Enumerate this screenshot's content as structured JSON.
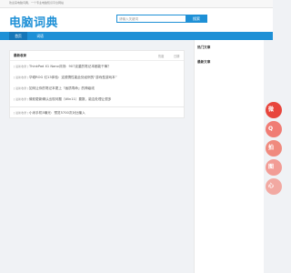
{
  "topbar": {
    "text": "欢迎来电脑词典，一个专业电脑知识平台网站"
  },
  "header": {
    "logo": "电脑词典",
    "search_placeholder": "请输入关键词",
    "search_button": "搜索"
  },
  "nav": {
    "tabs": [
      {
        "label": "首页",
        "active": true
      },
      {
        "label": "词语",
        "active": false
      }
    ]
  },
  "main": {
    "title": "最新收录",
    "col_status": "热度",
    "col_date": "日期",
    "rows": [
      {
        "category": "[ 最新收录 ]",
        "title": "ThinkPad X1 Nano评测：907克重的笔记本都能干嘛？"
      },
      {
        "category": "[ 最新收录 ]",
        "title": "华硕ROG 幻13体验：这便携性能此处经例的“游戏型游戏本”"
      },
      {
        "category": "[ 最新收录 ]",
        "title": "如何让你的笔记本更上『画质寿命』的神级线"
      },
      {
        "category": "[ 最新收录 ]",
        "title": "微软更新确认出现问题（Win11）要数，能否处理让很多"
      }
    ],
    "single": {
      "category": "[ 最新收录 ]",
      "title": "小米手机5曝光：预览5700次对比输入"
    }
  },
  "sidebar": {
    "hot_title": "热门文章",
    "latest_title": "最新文章"
  },
  "floats": [
    {
      "label": "微",
      "color": "#e8453c"
    },
    {
      "label": "Q",
      "color": "#f07c74"
    },
    {
      "label": "拍",
      "color": "#f08a7e"
    },
    {
      "label": "图",
      "color": "#f29c95"
    },
    {
      "label": "心",
      "color": "#f2a9a2"
    }
  ]
}
